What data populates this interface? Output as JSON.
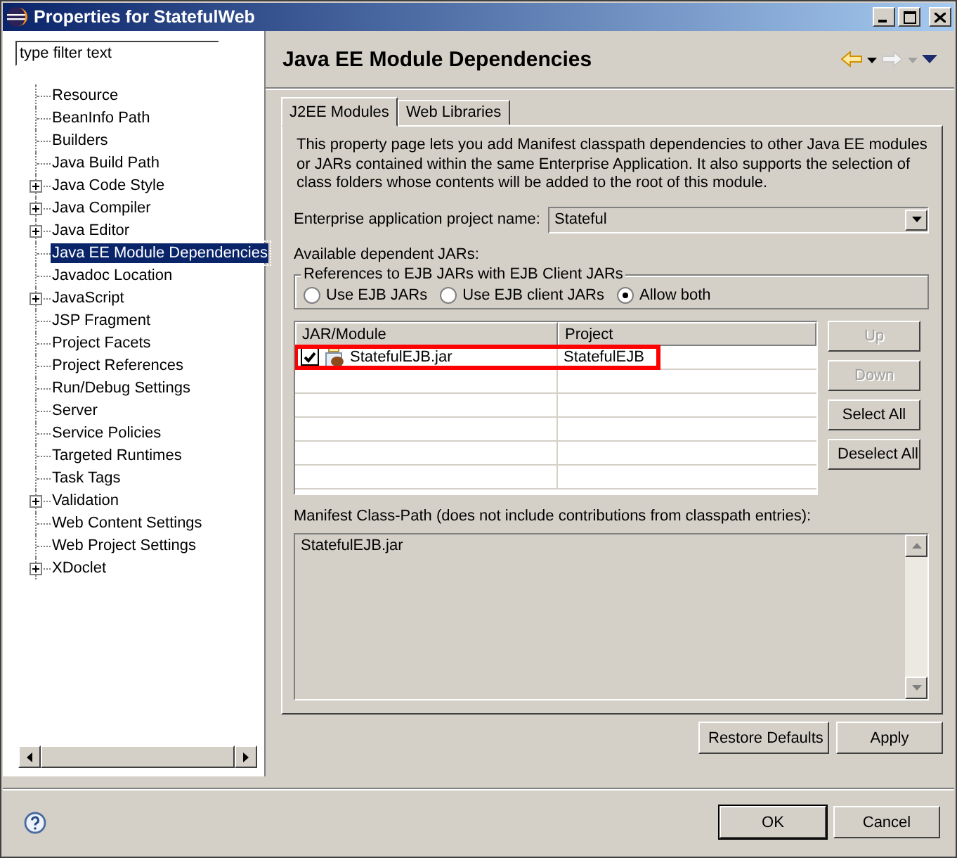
{
  "window": {
    "title": "Properties for StatefulWeb"
  },
  "filter": {
    "value": "type filter text"
  },
  "tree": [
    {
      "label": "Resource",
      "expandable": false,
      "selected": false,
      "highlighted": false
    },
    {
      "label": "BeanInfo Path",
      "expandable": false,
      "selected": false,
      "highlighted": false
    },
    {
      "label": "Builders",
      "expandable": false,
      "selected": false,
      "highlighted": false
    },
    {
      "label": "Java Build Path",
      "expandable": false,
      "selected": false,
      "highlighted": false
    },
    {
      "label": "Java Code Style",
      "expandable": true,
      "selected": false,
      "highlighted": false
    },
    {
      "label": "Java Compiler",
      "expandable": true,
      "selected": false,
      "highlighted": false
    },
    {
      "label": "Java Editor",
      "expandable": true,
      "selected": false,
      "highlighted": false
    },
    {
      "label": "Java EE Module Dependencies",
      "expandable": false,
      "selected": true,
      "highlighted": true
    },
    {
      "label": "Javadoc Location",
      "expandable": false,
      "selected": false,
      "highlighted": false
    },
    {
      "label": "JavaScript",
      "expandable": true,
      "selected": false,
      "highlighted": false
    },
    {
      "label": "JSP Fragment",
      "expandable": false,
      "selected": false,
      "highlighted": false
    },
    {
      "label": "Project Facets",
      "expandable": false,
      "selected": false,
      "highlighted": false
    },
    {
      "label": "Project References",
      "expandable": false,
      "selected": false,
      "highlighted": false
    },
    {
      "label": "Run/Debug Settings",
      "expandable": false,
      "selected": false,
      "highlighted": false
    },
    {
      "label": "Server",
      "expandable": false,
      "selected": false,
      "highlighted": false
    },
    {
      "label": "Service Policies",
      "expandable": false,
      "selected": false,
      "highlighted": false
    },
    {
      "label": "Targeted Runtimes",
      "expandable": false,
      "selected": false,
      "highlighted": false
    },
    {
      "label": "Task Tags",
      "expandable": false,
      "selected": false,
      "highlighted": false
    },
    {
      "label": "Validation",
      "expandable": true,
      "selected": false,
      "highlighted": false
    },
    {
      "label": "Web Content Settings",
      "expandable": false,
      "selected": false,
      "highlighted": false
    },
    {
      "label": "Web Project Settings",
      "expandable": false,
      "selected": false,
      "highlighted": false
    },
    {
      "label": "XDoclet",
      "expandable": true,
      "selected": false,
      "highlighted": false
    }
  ],
  "page": {
    "title": "Java EE Module Dependencies"
  },
  "tabs": [
    {
      "label": "J2EE Modules",
      "selected": true
    },
    {
      "label": "Web Libraries",
      "selected": false
    }
  ],
  "description": "This property page lets you add Manifest classpath dependencies to other Java EE modules or JARs contained within the same Enterprise Application. It also supports the selection of class folders whose contents will be added to the root of this module.",
  "project_name": {
    "label": "Enterprise application project name:",
    "value": "Stateful"
  },
  "jars_label": "Available dependent JARs:",
  "references": {
    "title": "References to EJB JARs with EJB Client JARs",
    "options": [
      {
        "label": "Use EJB JARs",
        "selected": false
      },
      {
        "label": "Use EJB client JARs",
        "selected": false
      },
      {
        "label": "Allow both",
        "selected": true
      }
    ]
  },
  "table": {
    "columns": [
      "JAR/Module",
      "Project"
    ],
    "rows": [
      {
        "jar": "StatefulEJB.jar",
        "project": "StatefulEJB",
        "checked": true,
        "highlighted": true
      }
    ]
  },
  "side_buttons": [
    {
      "label": "Up",
      "disabled": true
    },
    {
      "label": "Down",
      "disabled": true
    },
    {
      "label": "Select All",
      "disabled": false
    },
    {
      "label": "Deselect All",
      "disabled": false
    }
  ],
  "manifest": {
    "label": "Manifest Class-Path (does not include contributions from classpath entries):",
    "value": "StatefulEJB.jar"
  },
  "page_buttons": [
    "Restore Defaults",
    "Apply"
  ],
  "dialog_buttons": [
    {
      "label": "OK",
      "default": true
    },
    {
      "label": "Cancel",
      "default": false
    }
  ]
}
